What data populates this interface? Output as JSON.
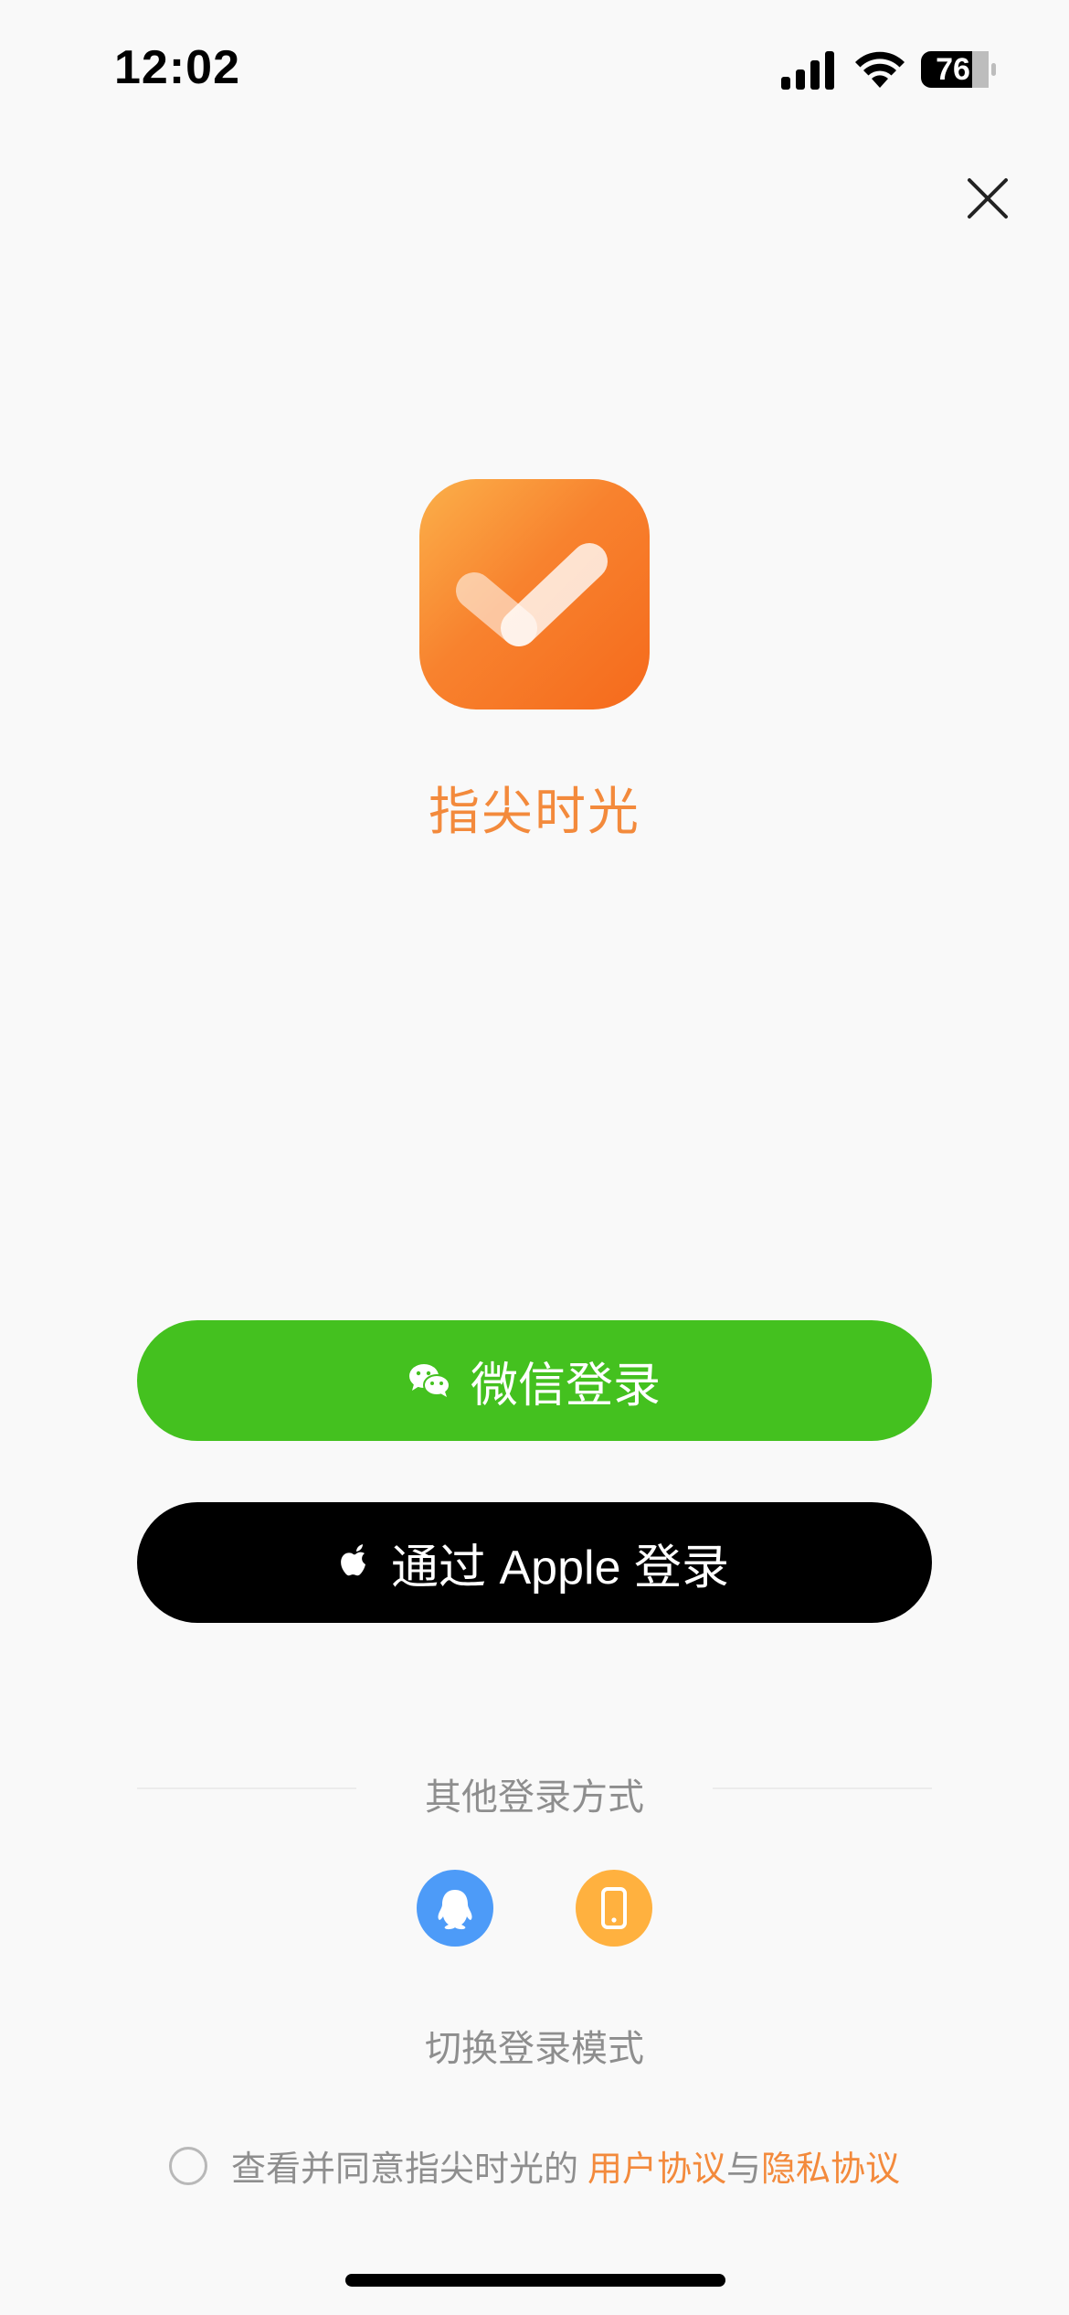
{
  "status_bar": {
    "time": "12:02",
    "battery_level": "76",
    "signal_icon": "cellular-signal-icon",
    "wifi_icon": "wifi-icon",
    "battery_icon": "battery-icon"
  },
  "header": {
    "close_icon": "close-icon"
  },
  "app": {
    "icon": "checkmark-app-icon",
    "name": "指尖时光",
    "name_color": "#f38a3c",
    "icon_gradient": [
      "#fbb04a",
      "#f56a1c"
    ]
  },
  "login_buttons": {
    "wechat": {
      "label": "微信登录",
      "icon": "wechat-icon",
      "color": "#44c11f"
    },
    "apple": {
      "label": "通过 Apple 登录",
      "icon": "apple-icon",
      "color": "#000000"
    }
  },
  "other_login": {
    "label": "其他登录方式",
    "options": [
      {
        "icon": "qq-icon",
        "color": "#4d9bf8"
      },
      {
        "icon": "phone-icon",
        "color": "#ffb13f"
      }
    ]
  },
  "switch_mode_label": "切换登录模式",
  "agreement": {
    "text": "查看并同意指尖时光的",
    "user_agreement": "用户协议",
    "connector": "与",
    "privacy_agreement": "隐私协议",
    "checked": false
  }
}
